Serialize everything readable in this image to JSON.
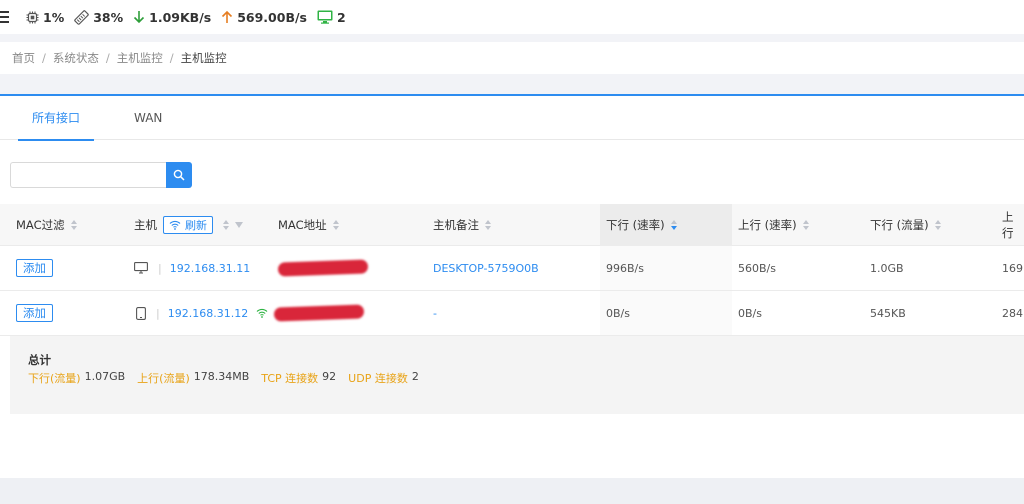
{
  "status": {
    "cpu": "1%",
    "memory": "38%",
    "download": "1.09KB/s",
    "upload": "569.00B/s",
    "online": "2",
    "colors": {
      "download": "#2e9e3a",
      "upload": "#e67e22",
      "monitor": "#2fb344"
    }
  },
  "breadcrumb": [
    "首页",
    "系统状态",
    "主机监控",
    "主机监控"
  ],
  "tabs": [
    {
      "label": "所有接口",
      "active": true
    },
    {
      "label": "WAN",
      "active": false
    }
  ],
  "search": {
    "value": "",
    "placeholder": ""
  },
  "table": {
    "columns": {
      "mac_filter": "MAC过滤",
      "host": "主机",
      "refresh": "刷新",
      "mac": "MAC地址",
      "note": "主机备注",
      "down_rate": "下行 (速率)",
      "up_rate": "上行 (速率)",
      "down_flow": "下行 (流量)",
      "up_flow": "上行"
    },
    "rows": [
      {
        "action": "添加",
        "device": "monitor-icon",
        "ip": "192.168.31.11",
        "wifi": false,
        "note": "DESKTOP-5759O0B",
        "down_rate": "996B/s",
        "up_rate": "560B/s",
        "down_flow": "1.0GB",
        "up_flow": "169."
      },
      {
        "action": "添加",
        "device": "phone-icon",
        "ip": "192.168.31.12",
        "wifi": true,
        "note": "-",
        "down_rate": "0B/s",
        "up_rate": "0B/s",
        "down_flow": "545KB",
        "up_flow": "284"
      }
    ]
  },
  "totals": {
    "title": "总计",
    "down_flow_label": "下行(流量)",
    "down_flow": "1.07GB",
    "up_flow_label": "上行(流量)",
    "up_flow": "178.34MB",
    "tcp_label": "TCP 连接数",
    "tcp": "92",
    "udp_label": "UDP 连接数",
    "udp": "2"
  }
}
